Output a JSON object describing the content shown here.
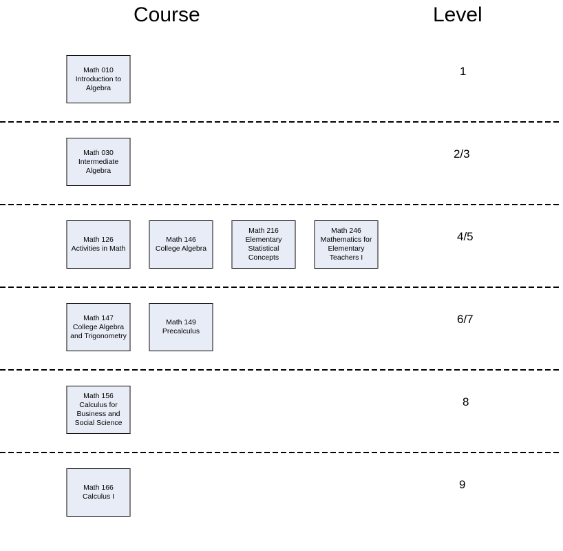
{
  "headers": {
    "course": "Course",
    "level": "Level"
  },
  "colors": {
    "box_fill": "#e8ecf6",
    "box_border": "#000000",
    "box_side": "#808080"
  },
  "rows": [
    {
      "level": "1",
      "courses": [
        {
          "number": "Math 010",
          "title": "Introduction to Algebra"
        }
      ]
    },
    {
      "level": "2/3",
      "courses": [
        {
          "number": "Math 030",
          "title": "Intermediate Algebra"
        }
      ]
    },
    {
      "level": "4/5",
      "courses": [
        {
          "number": "Math 126",
          "title": "Activities in Math"
        },
        {
          "number": "Math 146",
          "title": "College Algebra"
        },
        {
          "number": "Math 216",
          "title": "Elementary Statistical Concepts"
        },
        {
          "number": "Math 246",
          "title": "Mathematics for Elementary Teachers I"
        }
      ]
    },
    {
      "level": "6/7",
      "courses": [
        {
          "number": "Math 147",
          "title": "College Algebra and Trigonometry"
        },
        {
          "number": "Math 149",
          "title": "Precalculus"
        }
      ]
    },
    {
      "level": "8",
      "courses": [
        {
          "number": "Math 156",
          "title": "Calculus for Business and Social Science"
        }
      ]
    },
    {
      "level": "9",
      "courses": [
        {
          "number": "Math 166",
          "title": "Calculus I"
        }
      ]
    }
  ]
}
